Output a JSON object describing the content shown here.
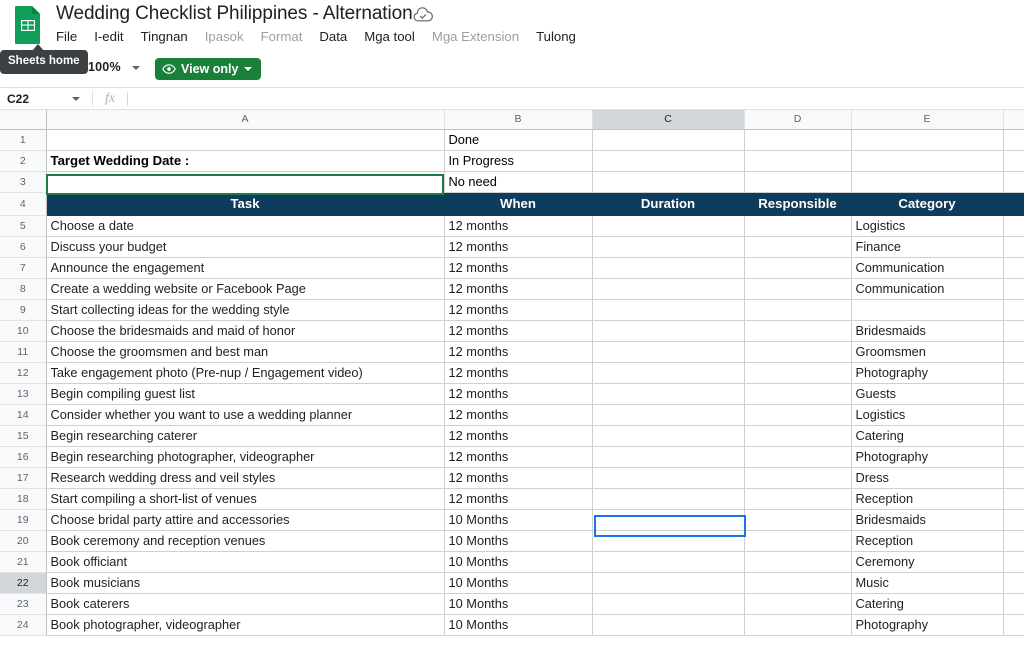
{
  "app": {
    "doc_icon": "sheets-doc-icon",
    "title": "Wedding Checklist Philippines - Alternation",
    "cloud_icon": "cloud-saved-icon",
    "tooltip": "Sheets home"
  },
  "menu": {
    "items": [
      {
        "label": "File",
        "dim": false
      },
      {
        "label": "I-edit",
        "dim": false
      },
      {
        "label": "Tingnan",
        "dim": false
      },
      {
        "label": "Ipasok",
        "dim": true
      },
      {
        "label": "Format",
        "dim": true
      },
      {
        "label": "Data",
        "dim": false
      },
      {
        "label": "Mga tool",
        "dim": false
      },
      {
        "label": "Mga Extension",
        "dim": true
      },
      {
        "label": "Tulong",
        "dim": false
      }
    ]
  },
  "toolbar": {
    "zoom": "100%",
    "view_only_label": "View only",
    "eye_icon": "eye-icon",
    "caret_icon": "chevron-down-icon"
  },
  "formula_bar": {
    "name_box": "C22",
    "fx_label": "fx",
    "value": ""
  },
  "grid": {
    "columns": [
      {
        "letter": "A",
        "selected": false
      },
      {
        "letter": "B",
        "selected": false
      },
      {
        "letter": "C",
        "selected": true
      },
      {
        "letter": "D",
        "selected": false
      },
      {
        "letter": "E",
        "selected": false
      }
    ],
    "legend": [
      {
        "row": "1",
        "label": "Done",
        "color": "#ffff00"
      },
      {
        "row": "2",
        "label": "In Progress",
        "color": "#00ff00"
      },
      {
        "row": "3",
        "label": "No need",
        "color": "#ff0000"
      }
    ],
    "target_date_label": "Target Wedding Date :",
    "target_date_value": "",
    "header_accent": "#0d3c5c",
    "headers": [
      "Task",
      "When",
      "Duration",
      "Responsible",
      "Category"
    ],
    "selected_cell": "C22",
    "selected_row": "22",
    "rows": [
      {
        "n": "5",
        "task": "Choose a date",
        "when": "12 months",
        "duration": "",
        "responsible": "",
        "category": "Logistics"
      },
      {
        "n": "6",
        "task": "Discuss your budget",
        "when": "12 months",
        "duration": "",
        "responsible": "",
        "category": "Finance"
      },
      {
        "n": "7",
        "task": "Announce the engagement",
        "when": "12 months",
        "duration": "",
        "responsible": "",
        "category": "Communication"
      },
      {
        "n": "8",
        "task": "Create a wedding website or Facebook Page",
        "when": "12 months",
        "duration": "",
        "responsible": "",
        "category": "Communication"
      },
      {
        "n": "9",
        "task": "Start collecting ideas for the wedding style",
        "when": "12 months",
        "duration": "",
        "responsible": "",
        "category": ""
      },
      {
        "n": "10",
        "task": "Choose the bridesmaids and maid of honor",
        "when": "12 months",
        "duration": "",
        "responsible": "",
        "category": "Bridesmaids"
      },
      {
        "n": "11",
        "task": "Choose the groomsmen and best man",
        "when": "12 months",
        "duration": "",
        "responsible": "",
        "category": "Groomsmen"
      },
      {
        "n": "12",
        "task": "Take engagement photo (Pre-nup / Engagement video)",
        "when": "12 months",
        "duration": "",
        "responsible": "",
        "category": "Photography"
      },
      {
        "n": "13",
        "task": "Begin compiling guest list",
        "when": "12 months",
        "duration": "",
        "responsible": "",
        "category": "Guests"
      },
      {
        "n": "14",
        "task": "Consider whether you want to use a wedding planner",
        "when": "12 months",
        "duration": "",
        "responsible": "",
        "category": "Logistics"
      },
      {
        "n": "15",
        "task": "Begin researching caterer",
        "when": "12 months",
        "duration": "",
        "responsible": "",
        "category": "Catering"
      },
      {
        "n": "16",
        "task": "Begin researching photographer, videographer",
        "when": "12 months",
        "duration": "",
        "responsible": "",
        "category": "Photography"
      },
      {
        "n": "17",
        "task": "Research wedding dress and veil styles",
        "when": "12 months",
        "duration": "",
        "responsible": "",
        "category": "Dress"
      },
      {
        "n": "18",
        "task": "Start compiling a short-list of venues",
        "when": "12 months",
        "duration": "",
        "responsible": "",
        "category": "Reception"
      },
      {
        "n": "19",
        "task": "Choose bridal party attire and accessories",
        "when": "10 Months",
        "duration": "",
        "responsible": "",
        "category": "Bridesmaids"
      },
      {
        "n": "20",
        "task": "Book ceremony and reception venues",
        "when": "10 Months",
        "duration": "",
        "responsible": "",
        "category": "Reception"
      },
      {
        "n": "21",
        "task": "Book officiant",
        "when": "10 Months",
        "duration": "",
        "responsible": "",
        "category": "Ceremony"
      },
      {
        "n": "22",
        "task": "Book musicians",
        "when": "10 Months",
        "duration": "",
        "responsible": "",
        "category": "Music"
      },
      {
        "n": "23",
        "task": "Book caterers",
        "when": "10 Months",
        "duration": "",
        "responsible": "",
        "category": "Catering"
      },
      {
        "n": "24",
        "task": "Book photographer, videographer",
        "when": "10 Months",
        "duration": "",
        "responsible": "",
        "category": "Photography"
      }
    ]
  }
}
